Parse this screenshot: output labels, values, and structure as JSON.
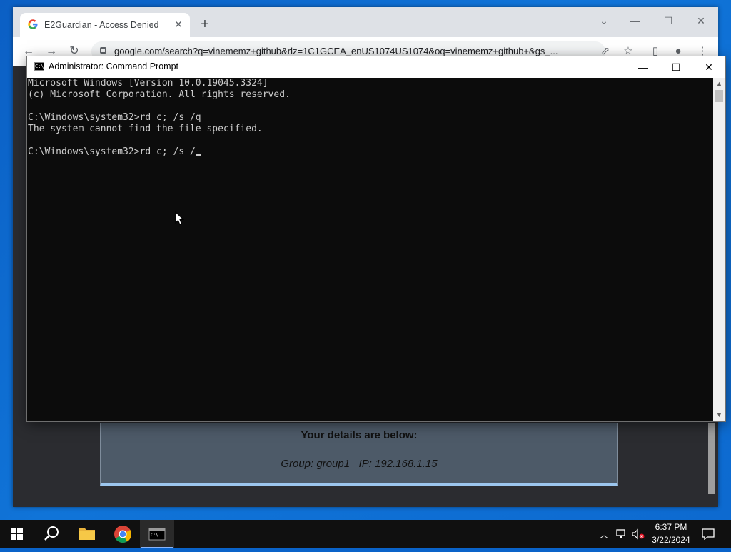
{
  "browser": {
    "tab_title": "E2Guardian - Access Denied",
    "favicon": "google-g-icon",
    "url": "google.com/search?q=vinememz+github&rlz=1C1GCEA_enUS1074US1074&oq=vinememz+github+&gs_..."
  },
  "page": {
    "details_heading": "Your details are below:",
    "details_line": "Group: group1   IP: 192.168.1.15"
  },
  "cmd": {
    "title": "Administrator: Command Prompt",
    "lines": [
      "Microsoft Windows [Version 10.0.19045.3324]",
      "(c) Microsoft Corporation. All rights reserved.",
      "",
      "C:\\Windows\\system32>rd c; /s /q",
      "The system cannot find the file specified.",
      "",
      "C:\\Windows\\system32>rd c; /s /"
    ]
  },
  "taskbar": {
    "apps": [
      "start-icon",
      "search-icon",
      "file-explorer-icon",
      "chrome-icon",
      "command-prompt-icon"
    ],
    "time": "6:37 PM",
    "date": "3/22/2024"
  },
  "colors": {
    "desktop": "#0b5fc4",
    "cmd_background": "#0c0c0c",
    "cmd_text": "#cccccc",
    "taskbar": "#101010"
  }
}
